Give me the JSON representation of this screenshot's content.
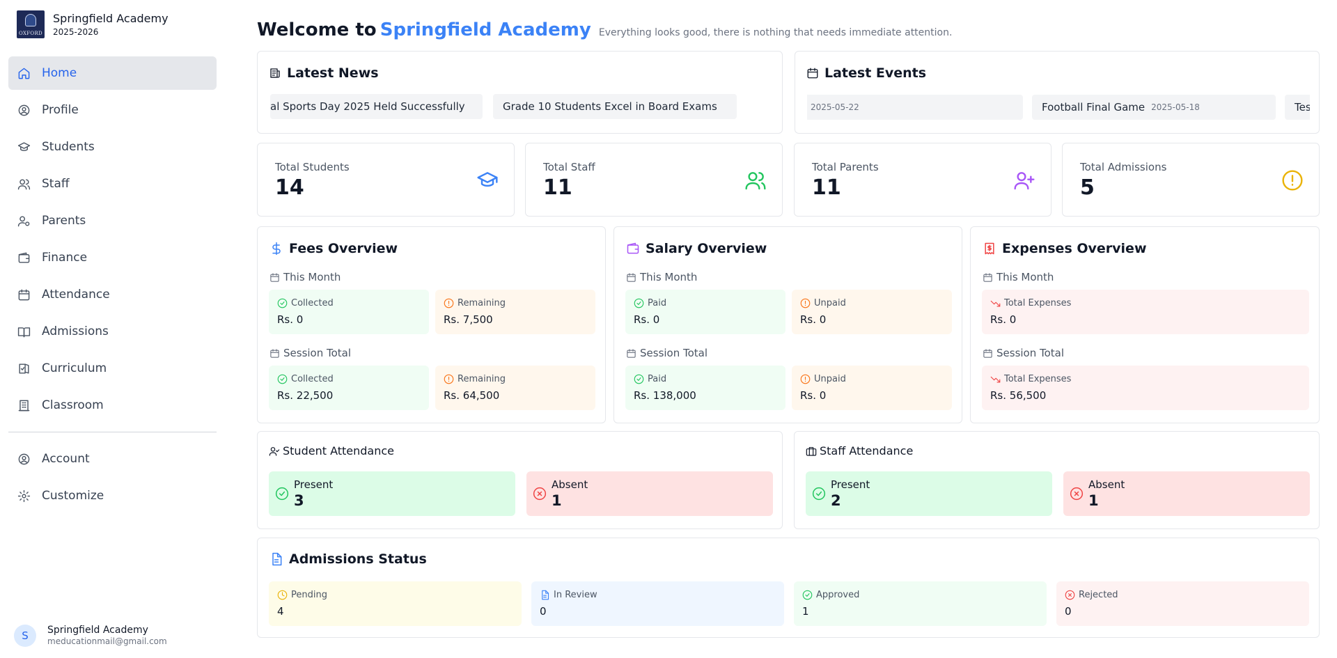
{
  "brand": {
    "name": "Springfield Academy",
    "year": "2025-2026",
    "logo_text": "OXFORD"
  },
  "nav": {
    "items": [
      {
        "label": "Home",
        "icon": "home-icon"
      },
      {
        "label": "Profile",
        "icon": "user-circle-icon"
      },
      {
        "label": "Students",
        "icon": "graduation-cap-icon"
      },
      {
        "label": "Staff",
        "icon": "users-icon"
      },
      {
        "label": "Parents",
        "icon": "user-cog-icon"
      },
      {
        "label": "Finance",
        "icon": "wallet-icon"
      },
      {
        "label": "Attendance",
        "icon": "calendar-icon"
      },
      {
        "label": "Admissions",
        "icon": "book-open-icon"
      },
      {
        "label": "Curriculum",
        "icon": "book-check-icon"
      },
      {
        "label": "Classroom",
        "icon": "building-icon"
      }
    ],
    "bottom": [
      {
        "label": "Account",
        "icon": "user-circle-icon"
      },
      {
        "label": "Customize",
        "icon": "gear-icon"
      }
    ]
  },
  "user": {
    "initial": "S",
    "name": "Springfield Academy",
    "email": "meducationmail@gmail.com"
  },
  "header": {
    "welcome": "Welcome to",
    "school": "Springfield Academy",
    "subtitle": "Everything looks good, there is nothing that needs immediate attention."
  },
  "news": {
    "title": "Latest News",
    "items": [
      "al Sports Day 2025 Held Successfully",
      "Grade 10 Students Excel in Board Exams"
    ]
  },
  "events": {
    "title": "Latest Events",
    "items": [
      {
        "name": "",
        "date": "2025-05-22"
      },
      {
        "name": "Football Final Game",
        "date": "2025-05-18"
      },
      {
        "name": "Tes",
        "date": ""
      }
    ]
  },
  "stats": [
    {
      "label": "Total Students",
      "value": "14",
      "icon": "graduation-cap-icon"
    },
    {
      "label": "Total Staff",
      "value": "11",
      "icon": "users-icon"
    },
    {
      "label": "Total Parents",
      "value": "11",
      "icon": "user-plus-icon"
    },
    {
      "label": "Total Admissions",
      "value": "5",
      "icon": "alert-circle-icon"
    }
  ],
  "fees": {
    "title": "Fees Overview",
    "this_month": "This Month",
    "session_total": "Session Total",
    "month_collected_label": "Collected",
    "month_collected": "Rs. 0",
    "month_remaining_label": "Remaining",
    "month_remaining": "Rs. 7,500",
    "session_collected_label": "Collected",
    "session_collected": "Rs. 22,500",
    "session_remaining_label": "Remaining",
    "session_remaining": "Rs. 64,500"
  },
  "salary": {
    "title": "Salary Overview",
    "this_month": "This Month",
    "session_total": "Session Total",
    "month_paid_label": "Paid",
    "month_paid": "Rs. 0",
    "month_unpaid_label": "Unpaid",
    "month_unpaid": "Rs. 0",
    "session_paid_label": "Paid",
    "session_paid": "Rs. 138,000",
    "session_unpaid_label": "Unpaid",
    "session_unpaid": "Rs. 0"
  },
  "expenses": {
    "title": "Expenses Overview",
    "this_month": "This Month",
    "session_total": "Session Total",
    "month_label": "Total Expenses",
    "month_value": "Rs. 0",
    "session_label": "Total Expenses",
    "session_value": "Rs. 56,500"
  },
  "student_attendance": {
    "title": "Student Attendance",
    "present_label": "Present",
    "present": "3",
    "absent_label": "Absent",
    "absent": "1"
  },
  "staff_attendance": {
    "title": "Staff Attendance",
    "present_label": "Present",
    "present": "2",
    "absent_label": "Absent",
    "absent": "1"
  },
  "admissions": {
    "title": "Admissions Status",
    "items": [
      {
        "label": "Pending",
        "value": "4",
        "icon": "clock-icon"
      },
      {
        "label": "In Review",
        "value": "0",
        "icon": "document-icon"
      },
      {
        "label": "Approved",
        "value": "1",
        "icon": "check-circle-icon"
      },
      {
        "label": "Rejected",
        "value": "0",
        "icon": "x-circle-icon"
      }
    ]
  },
  "colors": {
    "accent": "#3b82f6",
    "green": "#22c55e",
    "orange": "#f97316",
    "red": "#ef4444",
    "purple": "#a855f7",
    "yellow": "#eab308"
  }
}
